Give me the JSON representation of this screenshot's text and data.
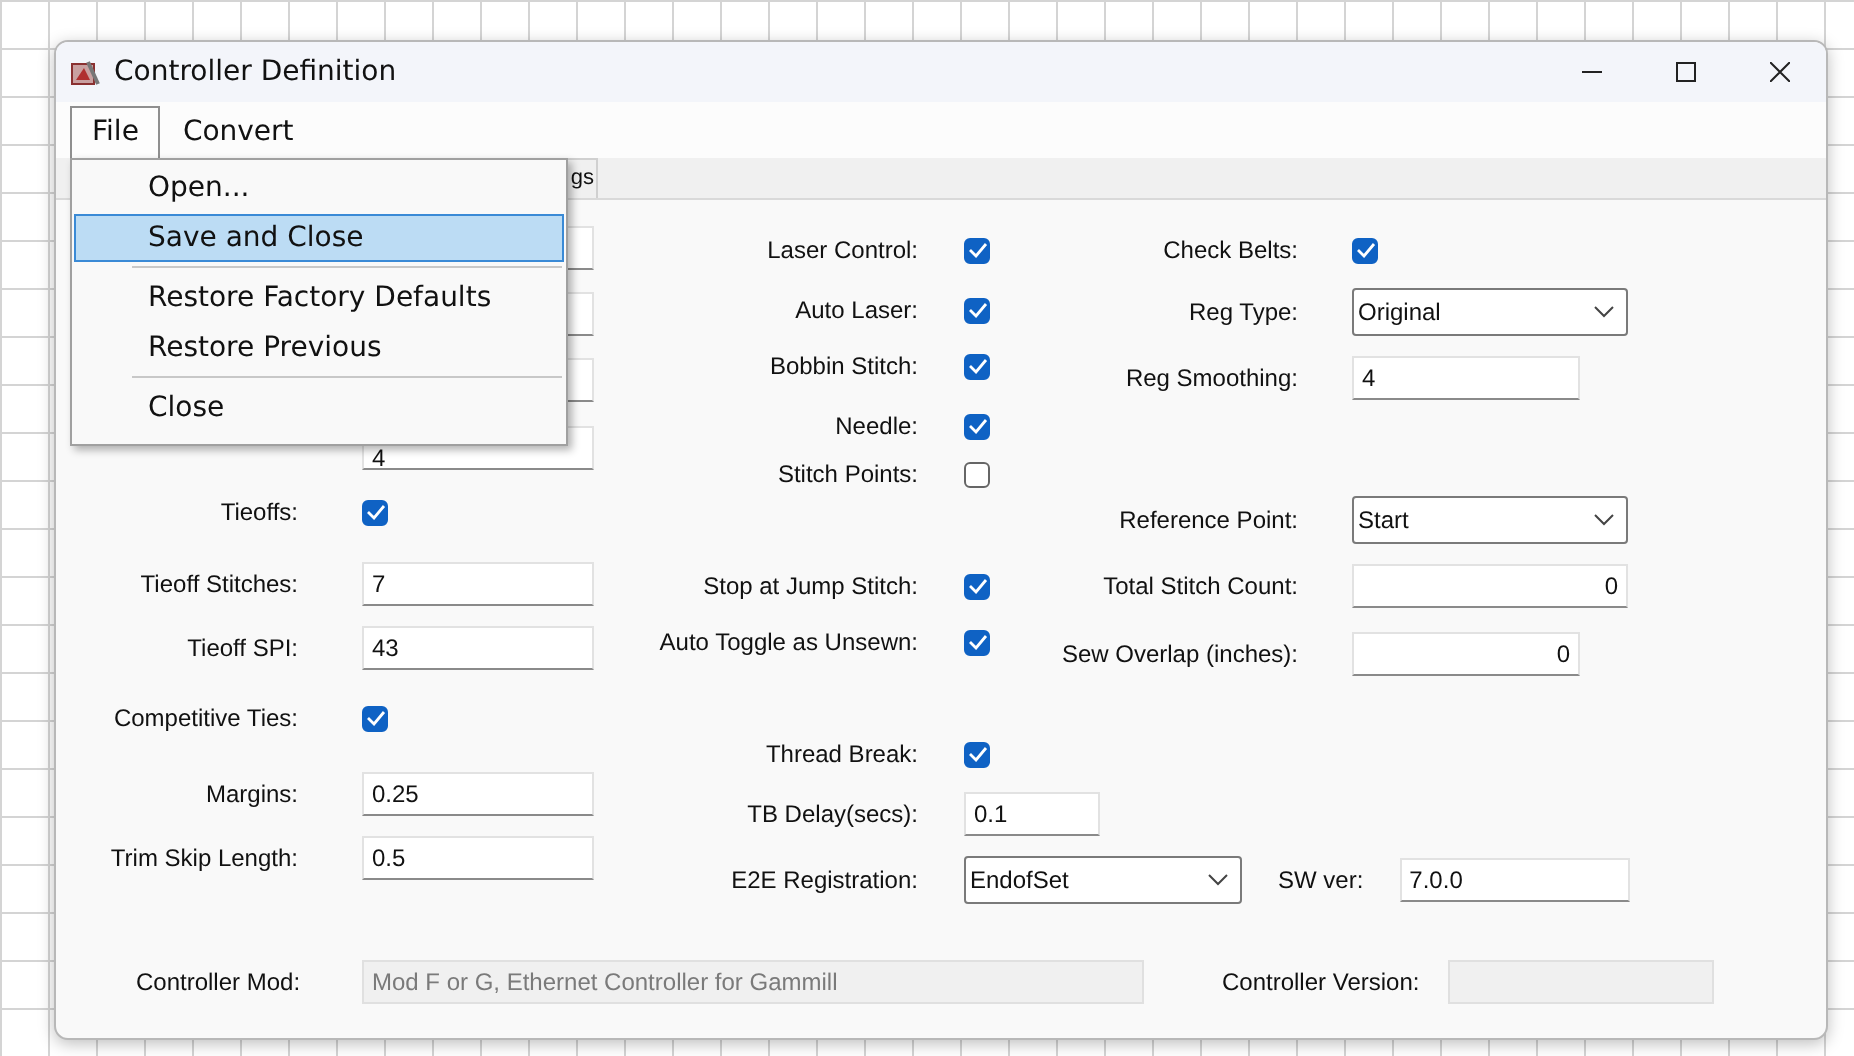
{
  "window": {
    "title": "Controller Definition"
  },
  "menu_bar": [
    {
      "label": "File",
      "selected": true
    },
    {
      "label": "Convert",
      "selected": false
    }
  ],
  "tabs": [
    {
      "label": "gs"
    }
  ],
  "file_menu": [
    {
      "kind": "item",
      "label": "Open...",
      "selected": false
    },
    {
      "kind": "item",
      "label": "Save and Close",
      "selected": true
    },
    {
      "kind": "separator"
    },
    {
      "kind": "item",
      "label": "Restore Factory Defaults",
      "selected": false
    },
    {
      "kind": "item",
      "label": "Restore Previous",
      "selected": false
    },
    {
      "kind": "separator"
    },
    {
      "kind": "item",
      "label": "Close",
      "selected": false
    }
  ],
  "form": {
    "left": [
      {
        "kind": "field"
      },
      {
        "kind": "field"
      },
      {
        "kind": "field"
      },
      {
        "kind": "field",
        "value": "4"
      },
      {
        "kind": "check",
        "label": "Tieoffs:",
        "checked": true
      },
      {
        "kind": "field",
        "label": "Tieoff Stitches:",
        "value": "7"
      },
      {
        "kind": "field",
        "label": "Tieoff SPI:",
        "value": "43"
      },
      {
        "kind": "check",
        "label": "Competitive Ties:",
        "checked": true
      },
      {
        "kind": "field",
        "label": "Margins:",
        "value": "0.25"
      },
      {
        "kind": "field",
        "label": "Trim Skip Length:",
        "value": "0.5"
      }
    ],
    "middle": [
      {
        "kind": "check",
        "label": "Laser Control:",
        "checked": true
      },
      {
        "kind": "check",
        "label": "Auto Laser:",
        "checked": true
      },
      {
        "kind": "check",
        "label": "Bobbin Stitch:",
        "checked": true
      },
      {
        "kind": "check",
        "label": "Needle:",
        "checked": true
      },
      {
        "kind": "check",
        "label": "Stitch Points:",
        "checked": false
      },
      {
        "kind": "check",
        "label": "Stop at Jump Stitch:",
        "checked": true
      },
      {
        "kind": "check",
        "label": "Auto Toggle as Unsewn:",
        "checked": true
      },
      {
        "kind": "check",
        "label": "Thread Break:",
        "checked": true
      },
      {
        "kind": "field",
        "label": "TB Delay(secs):",
        "value": "0.1"
      },
      {
        "kind": "combo",
        "label": "E2E Registration:",
        "value": "EndofSet",
        "extra": {
          "label": "SW ver:",
          "value": "7.0.0"
        }
      }
    ],
    "right": [
      {
        "kind": "check",
        "label": "Check Belts:",
        "checked": true
      },
      {
        "kind": "combo",
        "label": "Reg Type:",
        "value": "Original"
      },
      {
        "kind": "field",
        "label": "Reg Smoothing:",
        "value": "4"
      },
      {
        "kind": "combo",
        "label": "Reference Point:",
        "value": "Start"
      },
      {
        "kind": "number",
        "label": "Total Stitch Count:",
        "value": "0"
      },
      {
        "kind": "number",
        "label": "Sew Overlap (inches):",
        "value": "0"
      }
    ]
  },
  "footer": [
    {
      "label": "Controller Mod:",
      "value": "Mod F or G, Ethernet Controller for Gammill",
      "disabled": true
    },
    {
      "label": "Controller Version:",
      "disabled": true
    }
  ]
}
